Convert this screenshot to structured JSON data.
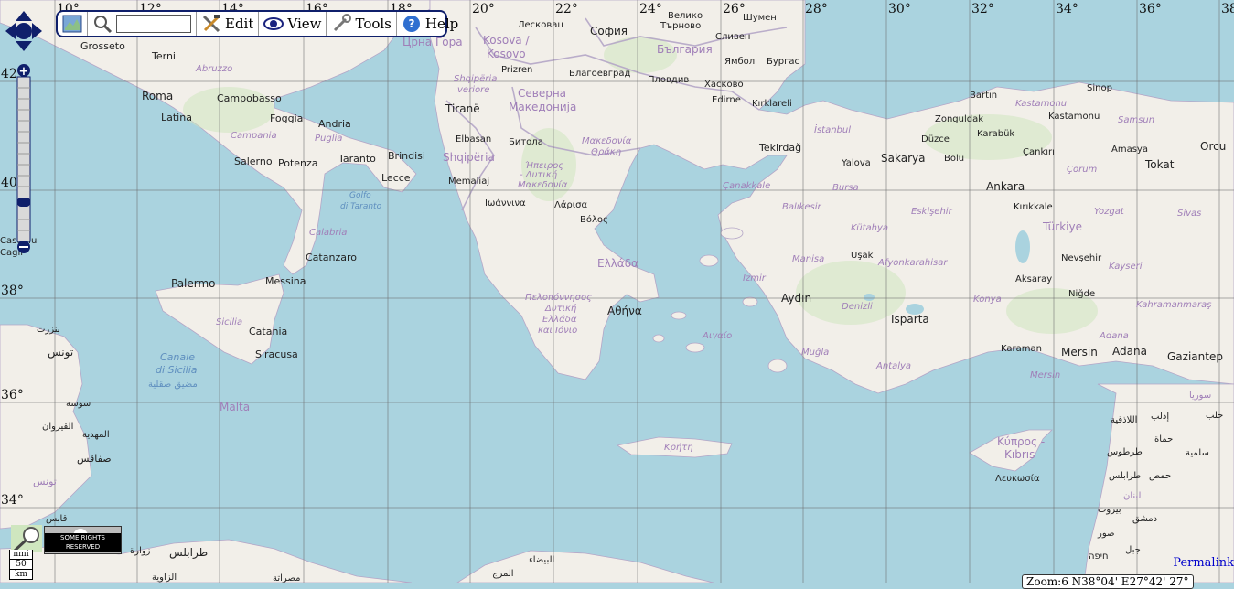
{
  "toolbar": {
    "search_placeholder": "",
    "edit_label": "Edit",
    "view_label": "View",
    "tools_label": "Tools",
    "help_label": "Help"
  },
  "grid": {
    "longitudes": [
      "10°",
      "12°",
      "14°",
      "16°",
      "18°",
      "20°",
      "22°",
      "24°",
      "26°",
      "28°",
      "30°",
      "32°",
      "34°",
      "36°",
      "38°"
    ],
    "latitudes": [
      "42°",
      "40°",
      "38°",
      "36°",
      "34°"
    ]
  },
  "places": {
    "grosseto": "Grosseto",
    "terni": "Terni",
    "abruzzo": "Abruzzo",
    "roma": "Roma",
    "latina": "Latina",
    "campobasso": "Campobasso",
    "foggia": "Foggia",
    "andria": "Andria",
    "campania": "Campania",
    "puglia": "Puglia",
    "salerno": "Salerno",
    "potenza": "Potenza",
    "taranto": "Taranto",
    "brindisi": "Brindisi",
    "lecce": "Lecce",
    "golfo": "Golfo",
    "di_taranto": "di Taranto",
    "calabria": "Calabria",
    "catanzaro": "Catanzaro",
    "palermo": "Palermo",
    "messina": "Messina",
    "sicilia": "Sicilia",
    "catania": "Catania",
    "siracusa": "Siracusa",
    "canale": "Canale",
    "di_sicilia": "di Sicilia",
    "madiq": "مضيق صقلية",
    "malta": "Malta",
    "castellucci": "Castellu",
    "cagliari": "Cagli",
    "bizerte": "بنزرت",
    "tunis": "تونس",
    "sousse": "سوسة",
    "kairouan": "القيروان",
    "mahdia": "المهدية",
    "sfax": "صفاقس",
    "tunisia": "تونس",
    "gabes": "قابس",
    "tripoli": "طرابلس",
    "zuwara": "زوارة",
    "zawiya": "الزاوية",
    "misrata": "مصراتة",
    "bayda": "البيضاء",
    "marj": "المرج",
    "crna_gora": "Црна Гора",
    "kosovo_sr": "Kosova /",
    "kosovo": "Kosovo",
    "prizren": "Prizren",
    "sofia": "София",
    "leskovac": "Лесковац",
    "veliko": "Велико",
    "tarnovo": "Търново",
    "shumen": "Шумен",
    "sliven": "Сливен",
    "yambol": "Ямбол",
    "burgas": "Бургас",
    "bulgaria": "България",
    "blagoevgrad": "Благоевград",
    "plovdiv": "Пловдив",
    "haskovo": "Хасково",
    "edirne": "Edirne",
    "kirklareli": "Kırklareli",
    "shqiperia_v": "Shqipëria",
    "veriore": "veriore",
    "tirane": "Tiranë",
    "severna": "Северна",
    "makedonija": "Македонија",
    "elbasan": "Elbasan",
    "bitola": "Битола",
    "shqiperia": "Shqipëria",
    "memaliaj": "Memaliaj",
    "makedonia_gr": "Μακεδονία",
    "thraki": "Θράκη",
    "ipeiros": "Ήπειρος",
    "dytiki": "- Δυτική",
    "makedonia2": "Μακεδονία",
    "ioannina": "Ιωάννινα",
    "larisa": "Λάρισα",
    "volos": "Βόλος",
    "ellada": "Ελλάδα",
    "peloponnisos": "Πελοπόννησος",
    "dytiki2": "Δυτική",
    "ellada2": "Ελλάδα",
    "ionio": "και Ιόνιο",
    "athina": "Αθήνα",
    "aigaio": "Αιγαίο",
    "kriti": "Κρήτη",
    "tekirdag": "Tekirdağ",
    "istanbul": "İstanbul",
    "canakkale": "Çanakkale",
    "bursa": "Bursa",
    "yalova": "Yalova",
    "sakarya": "Sakarya",
    "duzce": "Düzce",
    "bolu": "Bolu",
    "bartin": "Bartın",
    "zonguldak": "Zonguldak",
    "kastamonu_i": "Kastamonu",
    "kastamonu": "Kastamonu",
    "karabuk": "Karabük",
    "sinop": "Sinop",
    "samsun": "Samsun",
    "cankiri": "Çankırı",
    "corum": "Çorum",
    "amasya": "Amasya",
    "ordu": "Orcu",
    "tokat": "Tokat",
    "ankara": "Ankara",
    "eskisehir": "Eskişehir",
    "kirikkale": "Kırıkkale",
    "yozgat": "Yozgat",
    "sivas": "Sivas",
    "balikesir": "Balıkesir",
    "kutahya": "Kütahya",
    "turkiye": "Türkiye",
    "manisa": "Manisa",
    "usak": "Uşak",
    "afyon": "Afyonkarahisar",
    "nevsehir": "Nevşehir",
    "kayseri": "Kayseri",
    "izmir": "İzmir",
    "aydin": "Aydın",
    "denizli": "Denizli",
    "isparta": "Isparta",
    "konya": "Konya",
    "aksaray": "Aksaray",
    "nigde": "Niğde",
    "kahraman": "Kahramanmaraş",
    "mugla": "Muğla",
    "antalya": "Antalya",
    "karaman": "Karaman",
    "mersin": "Mersin",
    "mersin_i": "Mersin",
    "adana": "Adana",
    "adana_i": "Adana",
    "gaziantep": "Gaziantep",
    "kibris1": "Κύπρος -",
    "kibris2": "Kıbrıs",
    "lefkosa": "Λευκωσία",
    "latakia": "اللاذقية",
    "idlib": "إدلب",
    "hama": "حماة",
    "salamiya": "سلمية",
    "tartus": "طرطوس",
    "homs": "حمص",
    "tripoli_lb": "طرابلس",
    "lubnan": "لبنان",
    "beirut": "بيروت",
    "damascus": "دمشق",
    "sur": "صور",
    "haifa": "חיפה",
    "sheikh": "جبل",
    "halab": "حلب",
    "syr": "سوريا"
  },
  "scale": {
    "top": "nmi",
    "value": "50",
    "unit": "km"
  },
  "license": "SOME RIGHTS RESERVED",
  "permalink": "Permalink",
  "coords_readout": "Zoom:6 N38°04' E27°42' 27°"
}
